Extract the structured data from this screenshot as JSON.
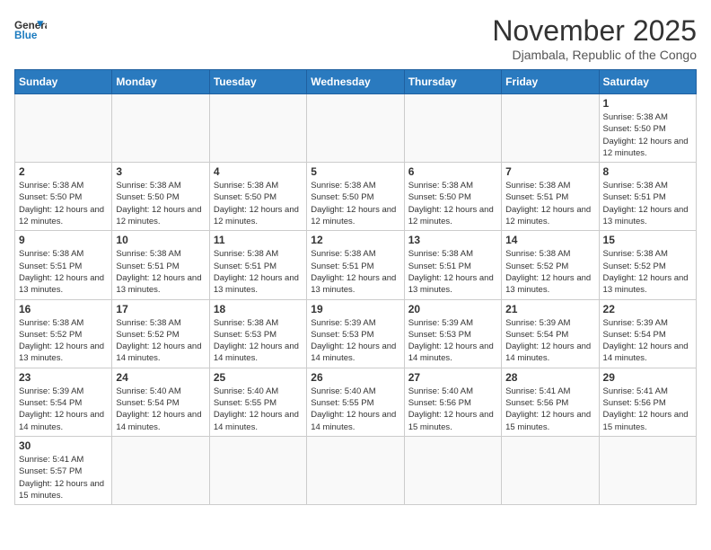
{
  "logo": {
    "text_general": "General",
    "text_blue": "Blue"
  },
  "title": {
    "month_year": "November 2025",
    "location": "Djambala, Republic of the Congo"
  },
  "weekdays": [
    "Sunday",
    "Monday",
    "Tuesday",
    "Wednesday",
    "Thursday",
    "Friday",
    "Saturday"
  ],
  "weeks": [
    [
      {
        "day": "",
        "info": ""
      },
      {
        "day": "",
        "info": ""
      },
      {
        "day": "",
        "info": ""
      },
      {
        "day": "",
        "info": ""
      },
      {
        "day": "",
        "info": ""
      },
      {
        "day": "",
        "info": ""
      },
      {
        "day": "1",
        "info": "Sunrise: 5:38 AM\nSunset: 5:50 PM\nDaylight: 12 hours and 12 minutes."
      }
    ],
    [
      {
        "day": "2",
        "info": "Sunrise: 5:38 AM\nSunset: 5:50 PM\nDaylight: 12 hours and 12 minutes."
      },
      {
        "day": "3",
        "info": "Sunrise: 5:38 AM\nSunset: 5:50 PM\nDaylight: 12 hours and 12 minutes."
      },
      {
        "day": "4",
        "info": "Sunrise: 5:38 AM\nSunset: 5:50 PM\nDaylight: 12 hours and 12 minutes."
      },
      {
        "day": "5",
        "info": "Sunrise: 5:38 AM\nSunset: 5:50 PM\nDaylight: 12 hours and 12 minutes."
      },
      {
        "day": "6",
        "info": "Sunrise: 5:38 AM\nSunset: 5:50 PM\nDaylight: 12 hours and 12 minutes."
      },
      {
        "day": "7",
        "info": "Sunrise: 5:38 AM\nSunset: 5:51 PM\nDaylight: 12 hours and 12 minutes."
      },
      {
        "day": "8",
        "info": "Sunrise: 5:38 AM\nSunset: 5:51 PM\nDaylight: 12 hours and 13 minutes."
      }
    ],
    [
      {
        "day": "9",
        "info": "Sunrise: 5:38 AM\nSunset: 5:51 PM\nDaylight: 12 hours and 13 minutes."
      },
      {
        "day": "10",
        "info": "Sunrise: 5:38 AM\nSunset: 5:51 PM\nDaylight: 12 hours and 13 minutes."
      },
      {
        "day": "11",
        "info": "Sunrise: 5:38 AM\nSunset: 5:51 PM\nDaylight: 12 hours and 13 minutes."
      },
      {
        "day": "12",
        "info": "Sunrise: 5:38 AM\nSunset: 5:51 PM\nDaylight: 12 hours and 13 minutes."
      },
      {
        "day": "13",
        "info": "Sunrise: 5:38 AM\nSunset: 5:51 PM\nDaylight: 12 hours and 13 minutes."
      },
      {
        "day": "14",
        "info": "Sunrise: 5:38 AM\nSunset: 5:52 PM\nDaylight: 12 hours and 13 minutes."
      },
      {
        "day": "15",
        "info": "Sunrise: 5:38 AM\nSunset: 5:52 PM\nDaylight: 12 hours and 13 minutes."
      }
    ],
    [
      {
        "day": "16",
        "info": "Sunrise: 5:38 AM\nSunset: 5:52 PM\nDaylight: 12 hours and 13 minutes."
      },
      {
        "day": "17",
        "info": "Sunrise: 5:38 AM\nSunset: 5:52 PM\nDaylight: 12 hours and 14 minutes."
      },
      {
        "day": "18",
        "info": "Sunrise: 5:38 AM\nSunset: 5:53 PM\nDaylight: 12 hours and 14 minutes."
      },
      {
        "day": "19",
        "info": "Sunrise: 5:39 AM\nSunset: 5:53 PM\nDaylight: 12 hours and 14 minutes."
      },
      {
        "day": "20",
        "info": "Sunrise: 5:39 AM\nSunset: 5:53 PM\nDaylight: 12 hours and 14 minutes."
      },
      {
        "day": "21",
        "info": "Sunrise: 5:39 AM\nSunset: 5:54 PM\nDaylight: 12 hours and 14 minutes."
      },
      {
        "day": "22",
        "info": "Sunrise: 5:39 AM\nSunset: 5:54 PM\nDaylight: 12 hours and 14 minutes."
      }
    ],
    [
      {
        "day": "23",
        "info": "Sunrise: 5:39 AM\nSunset: 5:54 PM\nDaylight: 12 hours and 14 minutes."
      },
      {
        "day": "24",
        "info": "Sunrise: 5:40 AM\nSunset: 5:54 PM\nDaylight: 12 hours and 14 minutes."
      },
      {
        "day": "25",
        "info": "Sunrise: 5:40 AM\nSunset: 5:55 PM\nDaylight: 12 hours and 14 minutes."
      },
      {
        "day": "26",
        "info": "Sunrise: 5:40 AM\nSunset: 5:55 PM\nDaylight: 12 hours and 14 minutes."
      },
      {
        "day": "27",
        "info": "Sunrise: 5:40 AM\nSunset: 5:56 PM\nDaylight: 12 hours and 15 minutes."
      },
      {
        "day": "28",
        "info": "Sunrise: 5:41 AM\nSunset: 5:56 PM\nDaylight: 12 hours and 15 minutes."
      },
      {
        "day": "29",
        "info": "Sunrise: 5:41 AM\nSunset: 5:56 PM\nDaylight: 12 hours and 15 minutes."
      }
    ],
    [
      {
        "day": "30",
        "info": "Sunrise: 5:41 AM\nSunset: 5:57 PM\nDaylight: 12 hours and 15 minutes."
      },
      {
        "day": "",
        "info": ""
      },
      {
        "day": "",
        "info": ""
      },
      {
        "day": "",
        "info": ""
      },
      {
        "day": "",
        "info": ""
      },
      {
        "day": "",
        "info": ""
      },
      {
        "day": "",
        "info": ""
      }
    ]
  ]
}
